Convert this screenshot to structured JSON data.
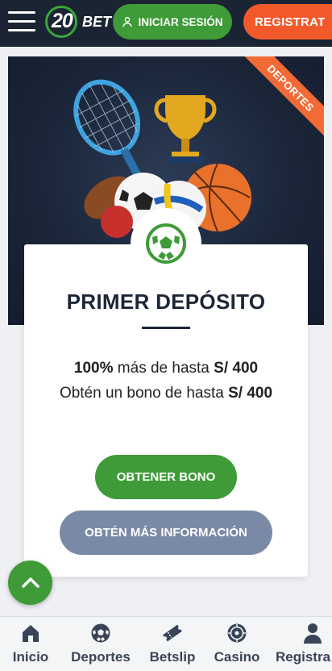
{
  "header": {
    "logo_number": "20",
    "logo_text": "BET",
    "login_label": "INICIAR SESIÓN",
    "register_label": "REGISTRAT"
  },
  "hero": {
    "ribbon_label": "DEPORTES"
  },
  "promo": {
    "title": "PRIMER DEPÓSITO",
    "line1_bold": "100%",
    "line1_text": " más de hasta ",
    "line1_amount": "S/ 400",
    "line2_text": "Obtén un bono de hasta ",
    "line2_amount": "S/ 400",
    "primary_button": "OBTENER BONO",
    "secondary_button": "OBTÉN MÁS INFORMACIÓN"
  },
  "bottom_nav": {
    "items": [
      {
        "label": "Inicio",
        "icon": "home-icon"
      },
      {
        "label": "Deportes",
        "icon": "soccer-ball-icon"
      },
      {
        "label": "Betslip",
        "icon": "ticket-icon"
      },
      {
        "label": "Casino",
        "icon": "roulette-icon"
      },
      {
        "label": "Registra",
        "icon": "user-icon"
      }
    ]
  },
  "colors": {
    "header_bg": "#1a2433",
    "brand_green": "#3e9b38",
    "brand_orange": "#f1592a",
    "info_button": "#7a8aa6",
    "ribbon": "#f26a36"
  }
}
